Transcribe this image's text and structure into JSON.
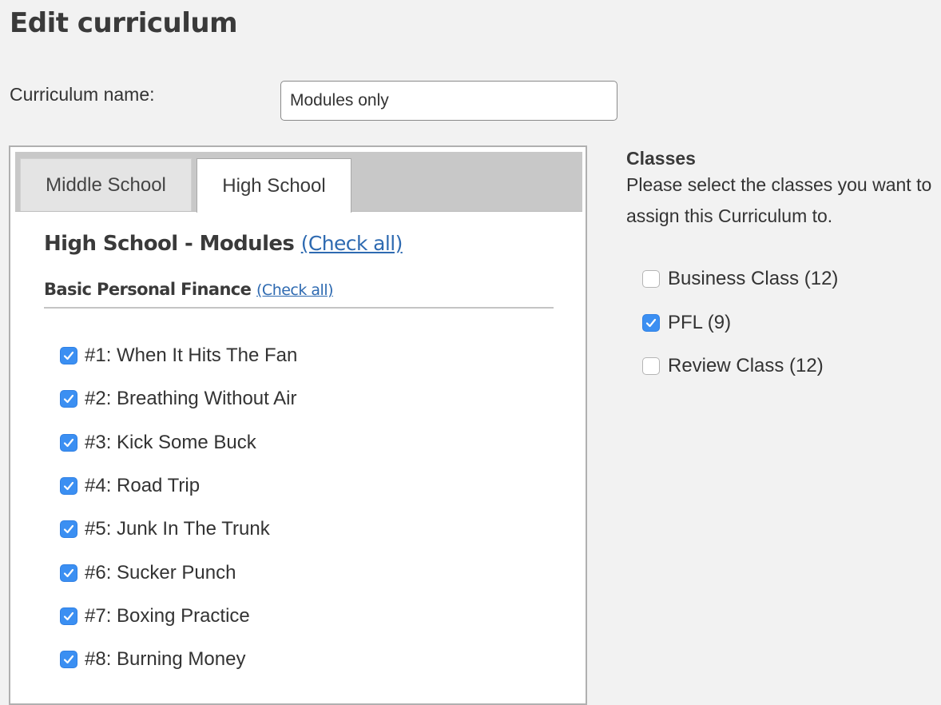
{
  "page": {
    "title": "Edit curriculum"
  },
  "form": {
    "name_label": "Curriculum name:",
    "name_value": "Modules only"
  },
  "tabs": [
    {
      "label": "Middle School",
      "active": false
    },
    {
      "label": "High School",
      "active": true
    }
  ],
  "section": {
    "heading": "High School - Modules",
    "check_all_label": "(Check all)",
    "subsection": {
      "heading": "Basic Personal Finance",
      "check_all_label": "(Check all)"
    },
    "modules": [
      {
        "label": "#1: When It Hits The Fan",
        "checked": true
      },
      {
        "label": "#2: Breathing Without Air",
        "checked": true
      },
      {
        "label": "#3: Kick Some Buck",
        "checked": true
      },
      {
        "label": "#4: Road Trip",
        "checked": true
      },
      {
        "label": "#5: Junk In The Trunk",
        "checked": true
      },
      {
        "label": "#6: Sucker Punch",
        "checked": true
      },
      {
        "label": "#7: Boxing Practice",
        "checked": true
      },
      {
        "label": "#8: Burning Money",
        "checked": true
      }
    ]
  },
  "classes": {
    "title": "Classes",
    "description": "Please select the classes you want to assign this Curriculum to.",
    "items": [
      {
        "label": "Business Class (12)",
        "checked": false
      },
      {
        "label": "PFL (9)",
        "checked": true
      },
      {
        "label": "Review Class (12)",
        "checked": false
      }
    ]
  },
  "colors": {
    "checkbox_checked": "#3b8ff2",
    "link": "#2e6ab1",
    "tab_bar": "#c8c8c8",
    "background": "#f2f2f2"
  }
}
